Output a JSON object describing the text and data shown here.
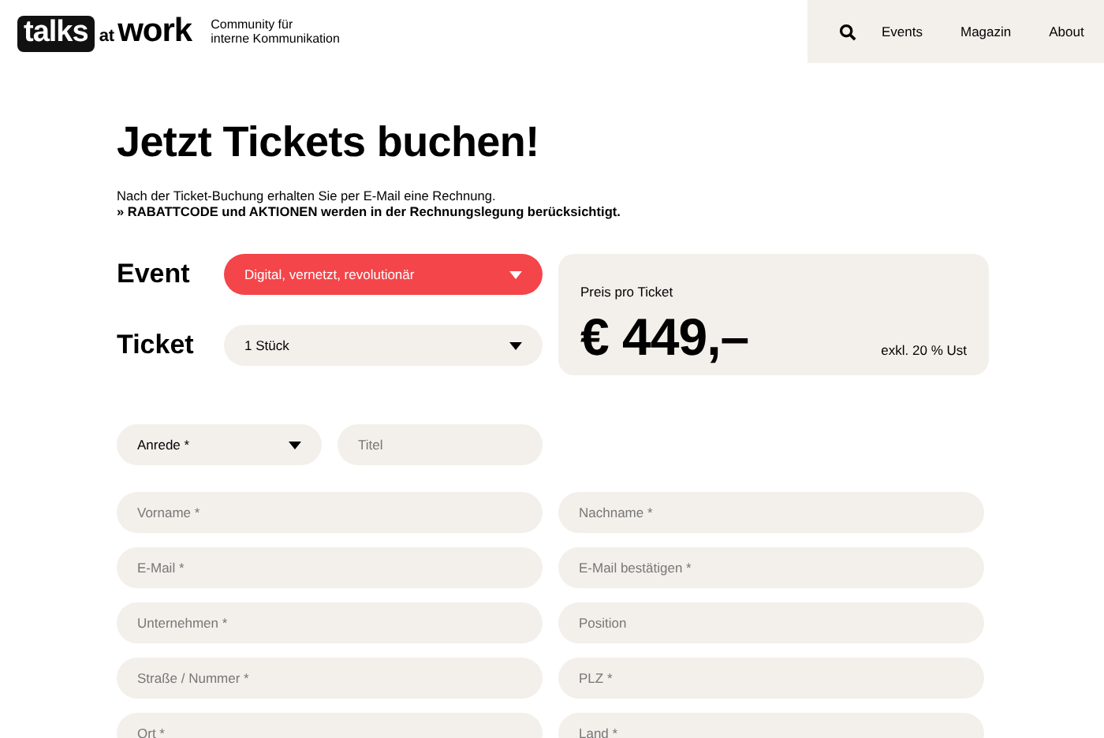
{
  "header": {
    "logo": {
      "part_1": "talks",
      "part_2": "at",
      "part_3": "work"
    },
    "tagline": [
      "Community für",
      "interne Kommunikation"
    ],
    "nav": [
      "Events",
      "Magazin",
      "About"
    ]
  },
  "heading": "Jetzt Tickets buchen!",
  "intro": [
    "Nach der Ticket-Buchung erhalten Sie per E-Mail eine Rechnung.",
    "» RABATTCODE und AKTIONEN werden in der Rechnungslegung berücksichtigt."
  ],
  "selectors": [
    {
      "label": "Event",
      "value": "Digital, vernetzt, revolutionär",
      "highlighted": true
    },
    {
      "label": "Ticket",
      "value": "1 Stück",
      "highlighted": false
    }
  ],
  "price": {
    "label": "Preis pro Ticket",
    "amount": "€ 449,–",
    "note": "exkl. 20 % Ust"
  },
  "salutation": {
    "value": "Anrede *"
  },
  "title_field": {
    "placeholder": "Titel"
  },
  "fields": [
    {
      "placeholder": "Vorname *"
    },
    {
      "placeholder": "Nachname *"
    },
    {
      "placeholder": "E-Mail *"
    },
    {
      "placeholder": "E-Mail bestätigen *"
    },
    {
      "placeholder": "Unternehmen *"
    },
    {
      "placeholder": "Position"
    },
    {
      "placeholder": "Straße / Nummer *"
    },
    {
      "placeholder": "PLZ *"
    },
    {
      "placeholder": "Ort *"
    },
    {
      "placeholder": "Land *"
    }
  ]
}
